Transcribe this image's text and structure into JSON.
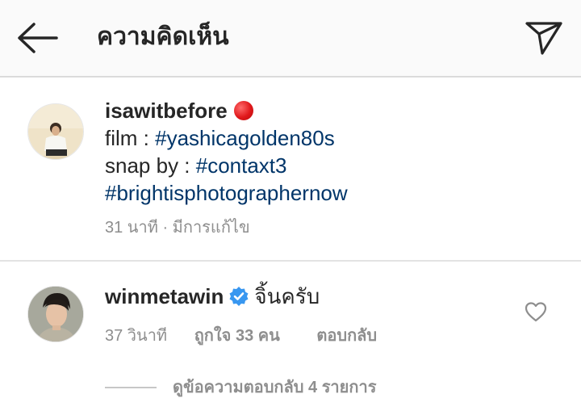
{
  "header": {
    "title": "ความคิดเห็น",
    "back_icon": "arrow-left-icon",
    "share_icon": "paper-plane-icon"
  },
  "post": {
    "username": "isawitbefore",
    "status_icon": "red-circle-icon",
    "lines": [
      {
        "prefix": "film : ",
        "hashtag": "#yashicagolden80s"
      },
      {
        "prefix": "snap by : ",
        "hashtag": "#contaxt3"
      },
      {
        "prefix": "",
        "hashtag": "#brightisphotographernow"
      }
    ],
    "meta": "31 นาที · มีการแก้ไข"
  },
  "comment": {
    "username": "winmetawin",
    "verified_icon": "verified-badge-icon",
    "text": "จิ้นครับ",
    "time": "37 วินาที",
    "likes": "ถูกใจ 33 คน",
    "reply": "ตอบกลับ",
    "like_icon": "heart-outline-icon"
  },
  "replies": {
    "label": "ดูข้อความตอบกลับ 4 รายการ"
  },
  "colors": {
    "hashtag": "#003569",
    "secondary_text": "#8e8e8e",
    "verified": "#3897f0",
    "header_bg": "#fafafa"
  }
}
